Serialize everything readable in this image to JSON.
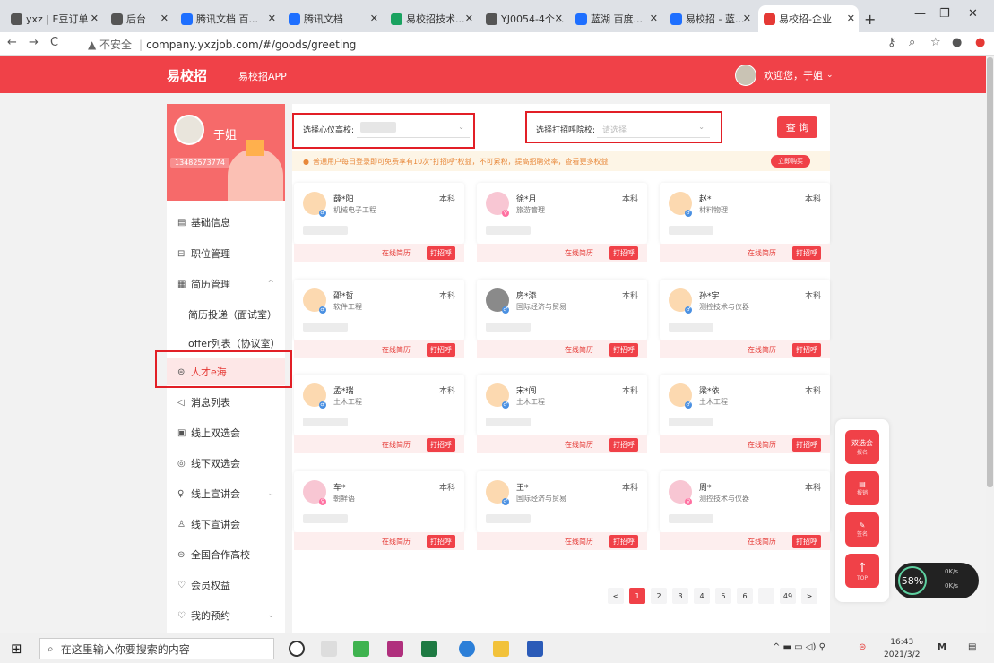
{
  "browser": {
    "tabs": [
      {
        "label": "yxz | E豆订单",
        "color": "#555"
      },
      {
        "label": "后台",
        "color": "#555"
      },
      {
        "label": "腾讯文档 百...",
        "color": "#1e6fff"
      },
      {
        "label": "腾讯文档",
        "color": "#1e6fff"
      },
      {
        "label": "易校招技术...",
        "color": "#1aa260"
      },
      {
        "label": "YJ0054-4个...",
        "color": "#555"
      },
      {
        "label": "蓝湖 百度...",
        "color": "#1e6fff"
      },
      {
        "label": "易校招 - 蓝...",
        "color": "#1e6fff"
      },
      {
        "label": "易校招-企业",
        "color": "#e53935"
      }
    ],
    "new_tab": "+",
    "url_warning": "▲ 不安全",
    "url": "company.yxzjob.com/#/goods/greeting"
  },
  "header": {
    "logo": "易校招",
    "app_link": "易校招APP",
    "welcome": "欢迎您，于姐",
    "dropdown": "⌄"
  },
  "profile": {
    "name": "于姐",
    "phone": "13482573774"
  },
  "sidebar": {
    "items": [
      {
        "icon": "▤",
        "label": "基础信息"
      },
      {
        "icon": "⊟",
        "label": "职位管理"
      },
      {
        "icon": "▦",
        "label": "简历管理",
        "chevron": "^"
      },
      {
        "label": "简历投递（面试室）"
      },
      {
        "label": "offer列表（协议室）"
      },
      {
        "icon": "⊜",
        "label": "人才e海"
      },
      {
        "icon": "◁",
        "label": "消息列表"
      },
      {
        "icon": "▣",
        "label": "线上双选会"
      },
      {
        "icon": "◎",
        "label": "线下双选会"
      },
      {
        "icon": "♀",
        "label": "线上宣讲会",
        "chevron": "⌄"
      },
      {
        "icon": "♙",
        "label": "线下宣讲会"
      },
      {
        "icon": "⊜",
        "label": "全国合作高校"
      },
      {
        "icon": "♡",
        "label": "会员权益"
      },
      {
        "icon": "♡",
        "label": "我的预约",
        "chevron": "⌄"
      }
    ]
  },
  "filters": {
    "school_label": "选择心仪高校:",
    "target_label": "选择打招呼院校:",
    "target_placeholder": "请选择",
    "query_button": "查 询"
  },
  "notice": {
    "text": "普通用户每日登录即可免费享有10次\"打招呼\"权益，不可累积，提高招聘效率，查看更多权益",
    "button": "立即购买"
  },
  "candidates": [
    {
      "name": "薛*阳",
      "major": "机械电子工程",
      "degree": "本科",
      "gender": "m"
    },
    {
      "name": "徐*月",
      "major": "旅游管理",
      "degree": "本科",
      "gender": "f"
    },
    {
      "name": "赵*",
      "major": "材料物理",
      "degree": "本科",
      "gender": "m"
    },
    {
      "name": "邵*哲",
      "major": "软件工程",
      "degree": "本科",
      "gender": "m"
    },
    {
      "name": "房*添",
      "major": "国际经济与贸易",
      "degree": "本科",
      "gender": "m",
      "photo": true
    },
    {
      "name": "孙*宇",
      "major": "测控技术与仪器",
      "degree": "本科",
      "gender": "m"
    },
    {
      "name": "孟*瑞",
      "major": "土木工程",
      "degree": "本科",
      "gender": "m"
    },
    {
      "name": "宋*闯",
      "major": "土木工程",
      "degree": "本科",
      "gender": "m"
    },
    {
      "name": "梁*依",
      "major": "土木工程",
      "degree": "本科",
      "gender": "m"
    },
    {
      "name": "车*",
      "major": "朝鲜语",
      "degree": "本科",
      "gender": "f"
    },
    {
      "name": "王*",
      "major": "国际经济与贸易",
      "degree": "本科",
      "gender": "m"
    },
    {
      "name": "周*",
      "major": "测控技术与仪器",
      "degree": "本科",
      "gender": "f"
    }
  ],
  "card_actions": {
    "resume": "在线简历",
    "greet": "打招呼"
  },
  "pagination": {
    "prev": "<",
    "pages": [
      "1",
      "2",
      "3",
      "4",
      "5",
      "6",
      "...",
      "49"
    ],
    "next": ">",
    "current": "1"
  },
  "float_bar": {
    "fair": "双选会",
    "fair_sub": "报名",
    "edit_sub": "报销",
    "sign_sub": "签名",
    "top": "TOP"
  },
  "speed_widget": {
    "percent": "58%",
    "up": "0K/s",
    "down": "0K/s"
  },
  "taskbar": {
    "search_placeholder": "在这里输入你要搜索的内容",
    "time": "16:43",
    "date": "2021/3/2"
  },
  "colors": {
    "brand": "#f04148",
    "highlight_box": "#e21f26"
  }
}
